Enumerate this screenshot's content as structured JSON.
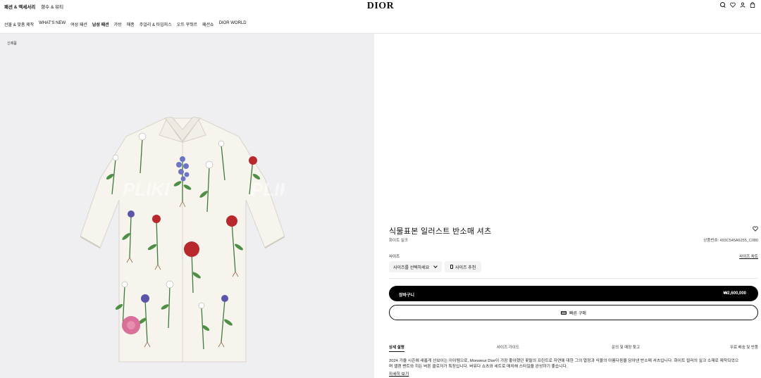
{
  "top": {
    "left_links": [
      "패션 & 액세서리",
      "향수 & 뷰티"
    ],
    "logo": "DIOR"
  },
  "nav": {
    "items": [
      "선물 & 맞춤 제작",
      "WHAT'S NEW",
      "여성 패션",
      "남성 패션",
      "가방",
      "매종",
      "주얼리 & 타임피스",
      "오뜨 꾸뛰르",
      "패션쇼",
      "DIOR WORLD"
    ]
  },
  "gallery": {
    "badge": "신제품",
    "watermark": "PLIKI"
  },
  "product": {
    "title": "식물표본 일러스트 반소매 셔츠",
    "subtitle": "화이트 실크",
    "reference": "상품번호: 493C545A6255_C080",
    "size_label": "사이즈",
    "size_guide": "사이즈 차트",
    "size_select": "사이즈를 선택하세요",
    "size_recommend": "사이즈 추천",
    "cart_label": "장바구니",
    "price": "₩2,600,000",
    "quick_buy": "빠른 구매"
  },
  "tabs": [
    "상세 설명",
    "사이즈 가이드",
    "문의 및 매장 찾고",
    "무료 배송 및 반품"
  ],
  "description": {
    "line1": "2024 가을 시즌에 새롭게 선보이는 아이템으로, Monsieur Dior이 가장 좋아했던 꽃들의 프린트로 자연에 대한 그의 열정과 식물의 아름다움을 담아낸 반소매 셔츠입니다. 화이트 컬러의 실크 소재로 제작되었으",
    "line2": "며 셸랜 밴트와 히든 버튼 클로저가 특징입니다. 버뮤다 쇼츠와 세트로 매치해 스타일을 완성하기 좋습니다.",
    "more": "자세히 보기"
  },
  "colors": {
    "accent": "#000000",
    "panel_bg": "#efeff1"
  }
}
